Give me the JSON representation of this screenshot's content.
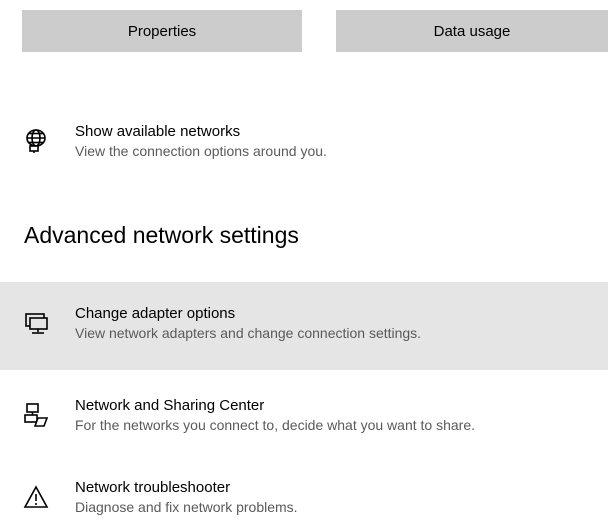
{
  "buttons": {
    "properties": "Properties",
    "data_usage": "Data usage"
  },
  "show_networks": {
    "title": "Show available networks",
    "description": "View the connection options around you.",
    "icon": "globe-network-icon"
  },
  "advanced": {
    "heading": "Advanced network settings",
    "items": [
      {
        "title": "Change adapter options",
        "description": "View network adapters and change connection settings.",
        "icon": "adapter-monitor-icon"
      },
      {
        "title": "Network and Sharing Center",
        "description": "For the networks you connect to, decide what you want to share.",
        "icon": "sharing-center-icon"
      },
      {
        "title": "Network troubleshooter",
        "description": "Diagnose and fix network problems.",
        "icon": "warning-triangle-icon"
      }
    ]
  },
  "colors": {
    "button_bg": "#cccccc",
    "hover_bg": "#e5e5e5",
    "secondary_text": "#5a5a5a"
  }
}
